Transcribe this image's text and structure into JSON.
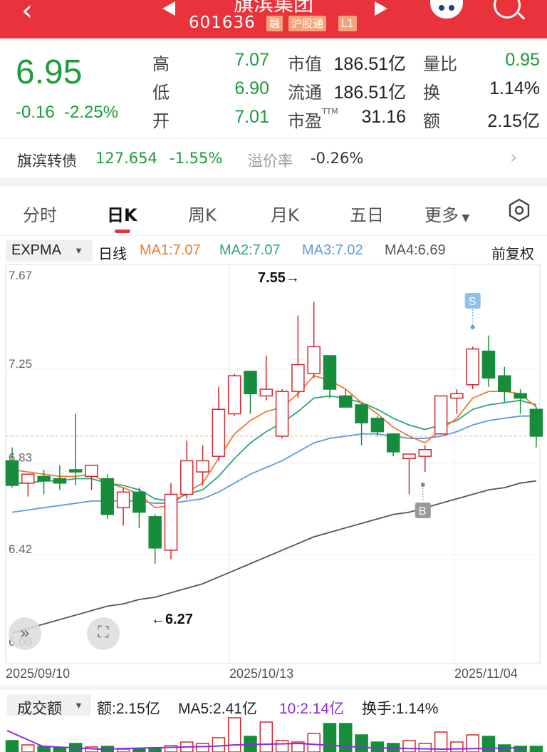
{
  "header": {
    "title": "旗滨集团",
    "code": "601636",
    "tags": [
      "融",
      "沪股通",
      "L1"
    ]
  },
  "quote": {
    "price": "6.95",
    "change": "-0.16",
    "change_pct": "-2.25%",
    "fields": [
      {
        "label": "高",
        "value": "7.07"
      },
      {
        "label": "低",
        "value": "6.90"
      },
      {
        "label": "开",
        "value": "7.01"
      },
      {
        "label": "市值",
        "value": "186.51亿"
      },
      {
        "label": "流通",
        "value": "186.51亿"
      },
      {
        "label": "市盈",
        "sup": "TTM",
        "value": "31.16"
      },
      {
        "label": "量比",
        "value": "0.95"
      },
      {
        "label": "换",
        "value": "1.14%"
      },
      {
        "label": "额",
        "value": "2.15亿"
      }
    ]
  },
  "bond": {
    "name": "旗滨转债",
    "price": "127.654",
    "change": "-1.55%",
    "premium_label": "溢价率",
    "premium": "-0.26%"
  },
  "tabs": [
    "分时",
    "日K",
    "周K",
    "月K",
    "五日",
    "更多"
  ],
  "indicator": {
    "name": "EXPMA",
    "period": "日线",
    "ma1": "MA1:7.07",
    "ma2": "MA2:7.07",
    "ma3": "MA3:7.02",
    "ma4": "MA4:6.69",
    "adjust": "前复权"
  },
  "colors": {
    "up": "#d4262e",
    "down": "#168d3a",
    "ma1": "#f07a2a",
    "ma2": "#2aa778",
    "ma3": "#5b9be0",
    "ma4": "#555555",
    "header": "#e8323c"
  },
  "chart_data": {
    "type": "candlestick",
    "ylim": [
      6.0,
      7.67
    ],
    "y_ticks": [
      "7.67",
      "7.25",
      "6.83",
      "6.42",
      "6.00"
    ],
    "dates": [
      "2025/09/10",
      "2025/10/13",
      "2025/11/04"
    ],
    "annotations": {
      "high": "7.55→",
      "low": "←6.27",
      "sell": "S",
      "buy": "B"
    },
    "candles": [
      {
        "o": 6.84,
        "h": 6.9,
        "l": 6.72,
        "c": 6.73
      },
      {
        "o": 6.74,
        "h": 6.78,
        "l": 6.68,
        "c": 6.78
      },
      {
        "o": 6.77,
        "h": 6.8,
        "l": 6.69,
        "c": 6.75
      },
      {
        "o": 6.76,
        "h": 6.82,
        "l": 6.71,
        "c": 6.74
      },
      {
        "o": 6.8,
        "h": 7.05,
        "l": 6.73,
        "c": 6.79
      },
      {
        "o": 6.77,
        "h": 6.82,
        "l": 6.71,
        "c": 6.82
      },
      {
        "o": 6.76,
        "h": 6.78,
        "l": 6.58,
        "c": 6.6
      },
      {
        "o": 6.63,
        "h": 6.72,
        "l": 6.55,
        "c": 6.7
      },
      {
        "o": 6.7,
        "h": 6.72,
        "l": 6.54,
        "c": 6.61
      },
      {
        "o": 6.59,
        "h": 6.6,
        "l": 6.38,
        "c": 6.45
      },
      {
        "o": 6.44,
        "h": 6.74,
        "l": 6.4,
        "c": 6.69
      },
      {
        "o": 6.69,
        "h": 6.93,
        "l": 6.67,
        "c": 6.84
      },
      {
        "o": 6.79,
        "h": 6.91,
        "l": 6.73,
        "c": 6.84
      },
      {
        "o": 6.86,
        "h": 7.17,
        "l": 6.84,
        "c": 7.07
      },
      {
        "o": 7.05,
        "h": 7.23,
        "l": 7.04,
        "c": 7.22
      },
      {
        "o": 7.24,
        "h": 7.24,
        "l": 7.05,
        "c": 7.14
      },
      {
        "o": 7.13,
        "h": 7.31,
        "l": 7.11,
        "c": 7.16
      },
      {
        "o": 6.95,
        "h": 7.16,
        "l": 6.94,
        "c": 7.15
      },
      {
        "o": 7.15,
        "h": 7.49,
        "l": 7.12,
        "c": 7.27
      },
      {
        "o": 7.23,
        "h": 7.55,
        "l": 7.21,
        "c": 7.35
      },
      {
        "o": 7.31,
        "h": 7.31,
        "l": 7.12,
        "c": 7.16
      },
      {
        "o": 7.13,
        "h": 7.16,
        "l": 7.08,
        "c": 7.08
      },
      {
        "o": 7.09,
        "h": 7.1,
        "l": 6.91,
        "c": 7.01
      },
      {
        "o": 7.03,
        "h": 7.04,
        "l": 6.95,
        "c": 6.97
      },
      {
        "o": 6.96,
        "h": 6.96,
        "l": 6.86,
        "c": 6.88
      },
      {
        "o": 6.85,
        "h": 6.86,
        "l": 6.69,
        "c": 6.87
      },
      {
        "o": 6.86,
        "h": 6.91,
        "l": 6.79,
        "c": 6.89
      },
      {
        "o": 6.96,
        "h": 7.13,
        "l": 6.96,
        "c": 7.13
      },
      {
        "o": 7.12,
        "h": 7.16,
        "l": 7.05,
        "c": 7.14
      },
      {
        "o": 7.18,
        "h": 7.35,
        "l": 7.16,
        "c": 7.34
      },
      {
        "o": 7.33,
        "h": 7.4,
        "l": 7.17,
        "c": 7.21
      },
      {
        "o": 7.22,
        "h": 7.26,
        "l": 7.1,
        "c": 7.15
      },
      {
        "o": 7.14,
        "h": 7.16,
        "l": 7.05,
        "c": 7.12
      },
      {
        "o": 7.07,
        "h": 7.08,
        "l": 6.9,
        "c": 6.95
      }
    ],
    "ma1": [
      6.8,
      6.79,
      6.78,
      6.77,
      6.77,
      6.78,
      6.74,
      6.72,
      6.69,
      6.63,
      6.64,
      6.7,
      6.74,
      6.85,
      6.96,
      7.02,
      7.06,
      7.08,
      7.14,
      7.22,
      7.2,
      7.16,
      7.1,
      7.05,
      6.99,
      6.95,
      6.92,
      6.98,
      7.03,
      7.12,
      7.15,
      7.15,
      7.14,
      7.08
    ],
    "ma2": [
      6.74,
      6.74,
      6.75,
      6.75,
      6.76,
      6.76,
      6.74,
      6.73,
      6.71,
      6.67,
      6.66,
      6.69,
      6.71,
      6.77,
      6.85,
      6.92,
      6.97,
      7.01,
      7.06,
      7.12,
      7.13,
      7.12,
      7.1,
      7.07,
      7.03,
      7.0,
      6.98,
      7.0,
      7.02,
      7.07,
      7.09,
      7.1,
      7.11,
      7.09
    ],
    "ma3": [
      6.61,
      6.62,
      6.63,
      6.64,
      6.65,
      6.66,
      6.66,
      6.66,
      6.66,
      6.65,
      6.65,
      6.66,
      6.67,
      6.7,
      6.74,
      6.78,
      6.81,
      6.84,
      6.88,
      6.92,
      6.94,
      6.95,
      6.96,
      6.96,
      6.95,
      6.94,
      6.94,
      6.95,
      6.97,
      7.0,
      7.02,
      7.03,
      7.04,
      7.04
    ],
    "ma4": [
      6.07,
      6.09,
      6.11,
      6.13,
      6.15,
      6.17,
      6.19,
      6.2,
      6.22,
      6.23,
      6.25,
      6.27,
      6.29,
      6.32,
      6.35,
      6.38,
      6.41,
      6.44,
      6.47,
      6.5,
      6.52,
      6.54,
      6.56,
      6.58,
      6.6,
      6.61,
      6.63,
      6.65,
      6.67,
      6.69,
      6.71,
      6.72,
      6.74,
      6.75
    ]
  },
  "volume": {
    "label": "成交额",
    "amount": "额:2.15亿",
    "ma5": "MA5:2.41亿",
    "ma10": "10:2.14亿",
    "turnover": "换手:1.14%"
  }
}
